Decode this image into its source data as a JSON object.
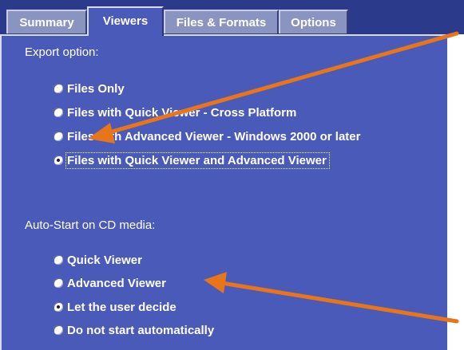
{
  "tabs": [
    {
      "label": "Summary",
      "active": false
    },
    {
      "label": "Viewers",
      "active": true
    },
    {
      "label": "Files & Formats",
      "active": false
    },
    {
      "label": "Options",
      "active": false
    }
  ],
  "export": {
    "heading": "Export option:",
    "options": [
      {
        "label": "Files Only",
        "checked": false
      },
      {
        "label": "Files with Quick Viewer - Cross Platform",
        "checked": false
      },
      {
        "label": "Files with Advanced Viewer - Windows 2000 or later",
        "checked": false
      },
      {
        "label": "Files with Quick Viewer and Advanced Viewer",
        "checked": true
      }
    ]
  },
  "autostart": {
    "heading": "Auto-Start on CD media:",
    "options": [
      {
        "label": "Quick Viewer",
        "checked": false
      },
      {
        "label": "Advanced Viewer",
        "checked": false
      },
      {
        "label": "Let the user decide",
        "checked": true
      },
      {
        "label": "Do not start automatically",
        "checked": false
      }
    ]
  },
  "colors": {
    "tabstrip": "#2c3a8c",
    "panel": "#4a5ab8",
    "inactive_tab": "#8a94c0",
    "annotation_arrow": "#e8751a"
  }
}
